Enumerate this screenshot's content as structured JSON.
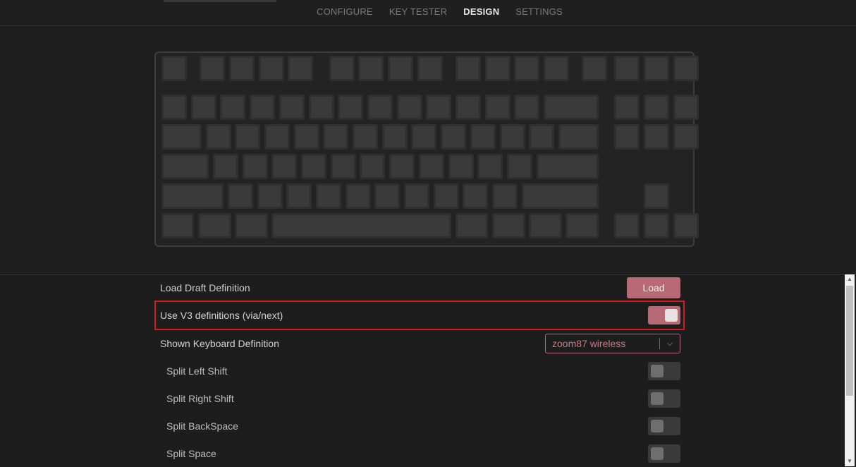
{
  "nav": {
    "tabs": [
      {
        "label": "CONFIGURE"
      },
      {
        "label": "KEY TESTER"
      },
      {
        "label": "DESIGN"
      },
      {
        "label": "SETTINGS"
      }
    ],
    "active_tab": "DESIGN"
  },
  "keyboard": {
    "layout": "TKL (87 keys)"
  },
  "panel": {
    "load_draft_label": "Load Draft Definition",
    "load_button_label": "Load",
    "v3_label": "Use V3 definitions (via/next)",
    "v3_enabled": true,
    "shown_definition_label": "Shown Keyboard Definition",
    "shown_definition_value": "zoom87 wireless",
    "options": [
      {
        "label": "Split Left Shift",
        "enabled": false
      },
      {
        "label": "Split Right Shift",
        "enabled": false
      },
      {
        "label": "Split BackSpace",
        "enabled": false
      },
      {
        "label": "Split Space",
        "enabled": false
      }
    ]
  },
  "colors": {
    "accent": "#b86a74",
    "highlight": "#d01b23",
    "background": "#1e1e1e"
  }
}
